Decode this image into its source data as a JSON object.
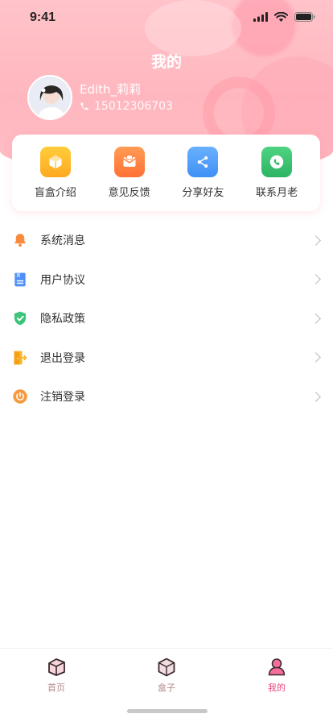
{
  "status_bar": {
    "time": "9:41"
  },
  "page": {
    "title": "我的"
  },
  "user": {
    "name": "Edith_莉莉",
    "phone": "15012306703"
  },
  "quick_actions": [
    {
      "label": "盲盒介绍",
      "icon": "gift-box-icon",
      "color": "#ffb928"
    },
    {
      "label": "意见反馈",
      "icon": "mail-feedback-icon",
      "color": "#ff8445"
    },
    {
      "label": "分享好友",
      "icon": "share-icon",
      "color": "#4f9df8"
    },
    {
      "label": "联系月老",
      "icon": "phone-icon",
      "color": "#35c06b"
    }
  ],
  "menu": [
    {
      "label": "系统消息",
      "icon": "bell-icon",
      "color": "#f98a3e"
    },
    {
      "label": "用户协议",
      "icon": "document-icon",
      "color": "#4f8ff7"
    },
    {
      "label": "隐私政策",
      "icon": "shield-check-icon",
      "color": "#3ec47a"
    },
    {
      "label": "退出登录",
      "icon": "logout-door-icon",
      "color": "#f8b42a"
    },
    {
      "label": "注销登录",
      "icon": "power-icon",
      "color": "#f79a3f"
    }
  ],
  "tab_bar": {
    "tabs": [
      {
        "label": "首页",
        "active": false
      },
      {
        "label": "盒子",
        "active": false
      },
      {
        "label": "我的",
        "active": true
      }
    ]
  },
  "colors": {
    "accent": "#e8457d",
    "header_pink": "#ffb7bf"
  }
}
